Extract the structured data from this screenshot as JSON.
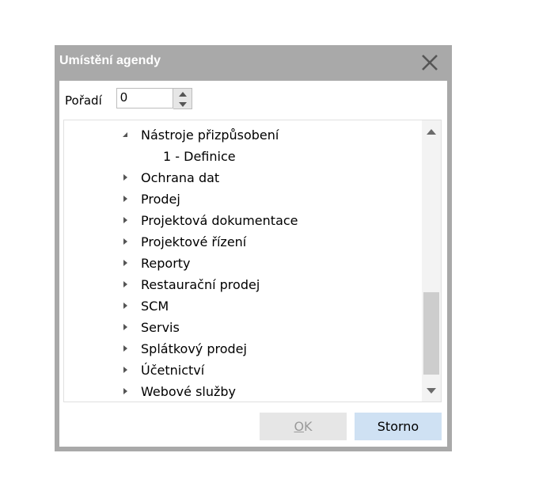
{
  "dialog": {
    "title": "Umístění agendy",
    "close_icon": "close-icon"
  },
  "order": {
    "label": "Pořadí",
    "value": "0"
  },
  "tree": {
    "items": [
      {
        "label": "Nástroje přizpůsobení",
        "state": "expanded",
        "level": 1
      },
      {
        "label": "1 - Definice",
        "state": "leaf",
        "level": 2
      },
      {
        "label": "Ochrana dat",
        "state": "collapsed",
        "level": 1
      },
      {
        "label": "Prodej",
        "state": "collapsed",
        "level": 1
      },
      {
        "label": "Projektová dokumentace",
        "state": "collapsed",
        "level": 1
      },
      {
        "label": "Projektové řízení",
        "state": "collapsed",
        "level": 1
      },
      {
        "label": "Reporty",
        "state": "collapsed",
        "level": 1
      },
      {
        "label": "Restaurační prodej",
        "state": "collapsed",
        "level": 1
      },
      {
        "label": "SCM",
        "state": "collapsed",
        "level": 1
      },
      {
        "label": "Servis",
        "state": "collapsed",
        "level": 1
      },
      {
        "label": "Splátkový prodej",
        "state": "collapsed",
        "level": 1
      },
      {
        "label": "Účetnictví",
        "state": "collapsed",
        "level": 1
      },
      {
        "label": "Webové služby",
        "state": "collapsed",
        "level": 1
      }
    ],
    "scroll_position": 0.72
  },
  "buttons": {
    "ok_label_mnemonic": "O",
    "ok_label_rest": "K",
    "cancel_label": "Storno"
  },
  "colors": {
    "dialog_frame": "#a9a9a9",
    "title_text": "#ffffff",
    "cancel_bg": "#cfe1f3",
    "ok_bg": "#e6e6e6"
  }
}
